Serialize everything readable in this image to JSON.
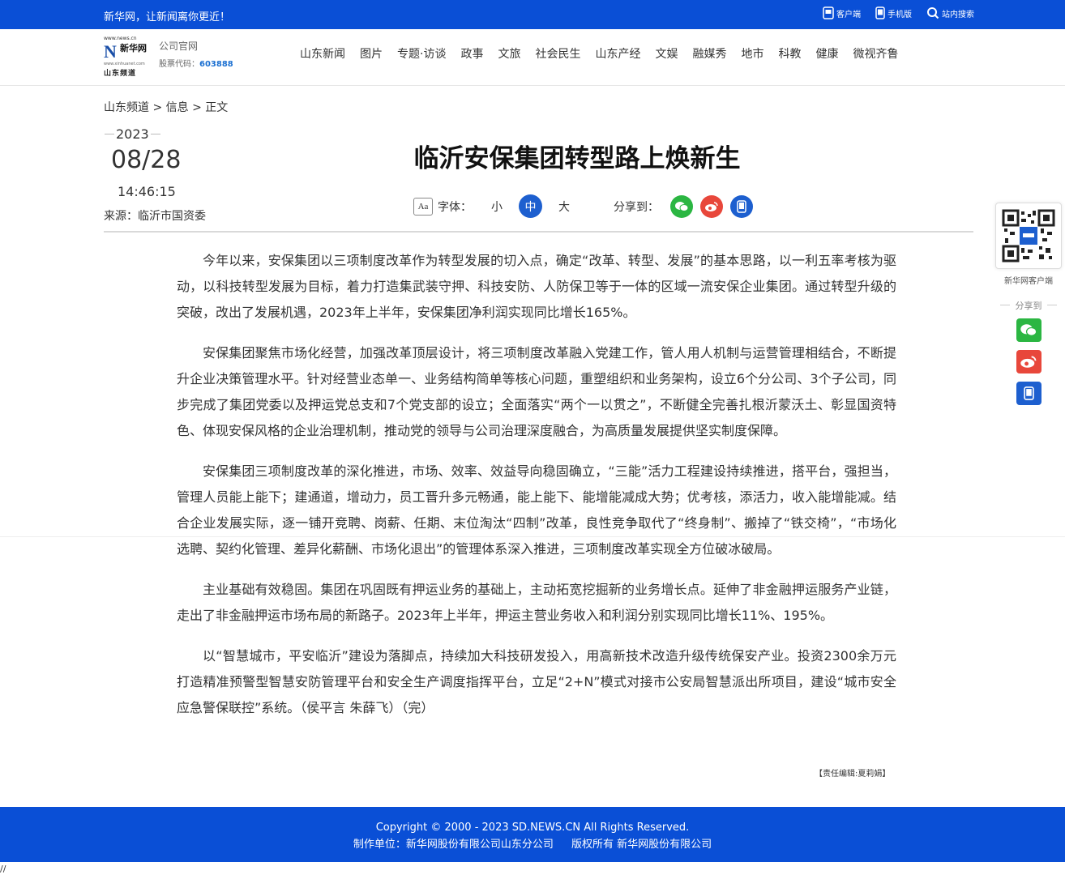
{
  "topbar": {
    "slogan": "新华网，让新闻离你更近！",
    "links": [
      "客户端",
      "手机版",
      "站内搜索"
    ]
  },
  "header": {
    "logo": {
      "url_top": "www.news.cn",
      "brand": "新华网",
      "url_bottom": "www.xinhuanet.com",
      "channel": "山东频道"
    },
    "company_label": "公司官网",
    "stock_label": "股票代码：",
    "stock_code": "603888",
    "nav": [
      "山东新闻",
      "图片",
      "专题·访谈",
      "政事",
      "文旅",
      "社会民生",
      "山东产经",
      "文娱",
      "融媒秀",
      "地市",
      "科教",
      "健康",
      "微视齐鲁"
    ]
  },
  "meta": {
    "breadcrumb": "山东频道 > 信息 > 正文",
    "year": "2023",
    "date": "08/28",
    "time": "14:46:15",
    "source": "来源：临沂市国资委"
  },
  "article": {
    "title": "临沂安保集团转型路上焕新生",
    "tools": {
      "font_label": "字体：",
      "small": "小",
      "medium": "中",
      "large": "大",
      "share_label": "分享到："
    },
    "paragraphs": [
      "今年以来，安保集团以三项制度改革作为转型发展的切入点，确定“改革、转型、发展”的基本思路，以一利五率考核为驱动，以科技转型发展为目标，着力打造集武装守押、科技安防、人防保卫等于一体的区域一流安保企业集团。通过转型升级的突破，改出了发展机遇，2023年上半年，安保集团净利润实现同比增长165%。",
      "安保集团聚焦市场化经营，加强改革顶层设计，将三项制度改革融入党建工作，管人用人机制与运营管理相结合，不断提升企业决策管理水平。针对经营业态单一、业务结构简单等核心问题，重塑组织和业务架构，设立6个分公司、3个子公司，同步完成了集团党委以及押运党总支和7个党支部的设立；全面落实“两个一以贯之”，不断健全完善扎根沂蒙沃土、彰显国资特色、体现安保风格的企业治理机制，推动党的领导与公司治理深度融合，为高质量发展提供坚实制度保障。",
      "安保集团三项制度改革的深化推进，市场、效率、效益导向稳固确立，“三能”活力工程建设持续推进，搭平台，强担当，管理人员能上能下；建通道，增动力，员工晋升多元畅通，能上能下、能增能减成大势；优考核，添活力，收入能增能减。结合企业发展实际，逐一铺开竞聘、岗薪、任期、末位淘汰“四制”改革，良性竞争取代了“终身制”、搬掉了“铁交椅”，“市场化选聘、契约化管理、差异化薪酬、市场化退出”的管理体系深入推进，三项制度改革实现全方位破冰破局。",
      "主业基础有效稳固。集团在巩固既有押运业务的基础上，主动拓宽挖掘新的业务增长点。延伸了非金融押运服务产业链，走出了非金融押运市场布局的新路子。2023年上半年，押运主营业务收入和利润分别实现同比增长11%、195%。",
      "以“智慧城市，平安临沂”建设为落脚点，持续加大科技研发投入，用高新技术改造升级传统保安产业。投资2300余万元打造精准预警型智慧安防管理平台和安全生产调度指挥平台，立足“2+N”模式对接市公安局智慧派出所项目，建设“城市安全应急警保联控”系统。（侯平言 朱薛飞）（完）"
    ],
    "editor": "【责任编辑:夏莉娟】"
  },
  "float_panel": {
    "qr_caption": "新华网客户端",
    "share_label": "分享到"
  },
  "footer": {
    "copyright": "Copyright © 2000 - 2023 SD.NEWS.CN    All Rights Reserved.",
    "producer": "制作单位：新华网股份有限公司山东分公司",
    "rights": "版权所有 新华网股份有限公司"
  },
  "misc": {
    "corner_text": "//"
  },
  "colors": {
    "brand_blue": "#0a4fd6",
    "wechat_green": "#2bb642",
    "weibo_red": "#e8473b",
    "accent_blue": "#1d5fcf"
  },
  "icons": [
    "client-icon",
    "mobile-icon",
    "search-icon",
    "font-size-icon",
    "wechat-icon",
    "weibo-icon",
    "phone-icon",
    "qr-code"
  ]
}
